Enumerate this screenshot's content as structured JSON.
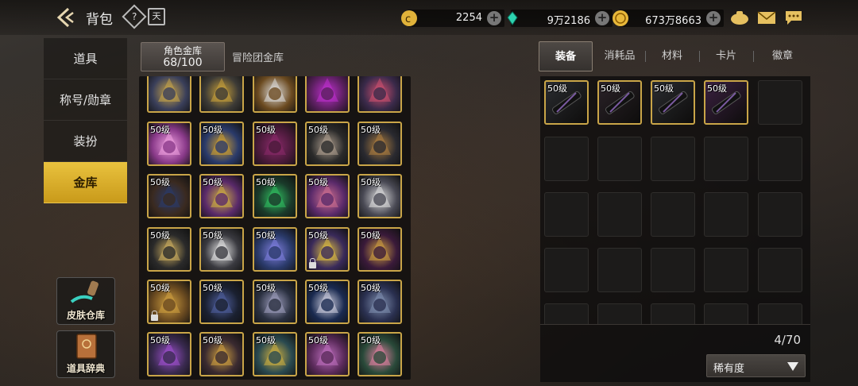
{
  "header": {
    "title": "背包",
    "help_glyph": "?",
    "calendar_glyph": "天",
    "currencies": [
      {
        "name": "gold-coin",
        "value": "2254",
        "color": "#e0b23a"
      },
      {
        "name": "crystal",
        "value": "9万2186",
        "color": "#2ed3b0"
      },
      {
        "name": "gold-medal",
        "value": "673万8663",
        "color": "#e8b83a"
      }
    ]
  },
  "sidebar": {
    "items": [
      {
        "label": "道具"
      },
      {
        "label": "称号/勋章"
      },
      {
        "label": "装扮"
      },
      {
        "label": "金库"
      }
    ],
    "shortcuts": [
      {
        "label": "皮肤仓库"
      },
      {
        "label": "道具辞典"
      }
    ]
  },
  "vault": {
    "tab_active_line1": "角色金库",
    "tab_active_line2": "68/100",
    "tab_other": "冒险团金库"
  },
  "grid_items": [
    {
      "level": "",
      "color": "#3a3f5a",
      "accent": "#c9a548",
      "rarity": "gold"
    },
    {
      "level": "",
      "color": "#3c3a36",
      "accent": "#caa23a",
      "rarity": "gold"
    },
    {
      "level": "",
      "color": "#6b4a20",
      "accent": "#ddd",
      "rarity": "gold"
    },
    {
      "level": "",
      "color": "#5a1f5e",
      "accent": "#c030d0",
      "rarity": "gold"
    },
    {
      "level": "",
      "color": "#3a2a4a",
      "accent": "#d05070",
      "rarity": "gold"
    },
    {
      "level": "50级",
      "color": "#8a3a8a",
      "accent": "#f0a0e0",
      "rarity": "gold"
    },
    {
      "level": "50级",
      "color": "#2a3a6a",
      "accent": "#d0a030",
      "rarity": "gold"
    },
    {
      "level": "50级",
      "color": "#4a1a3a",
      "accent": "#8a2a6a",
      "rarity": "gold"
    },
    {
      "level": "50级",
      "color": "#2a2a2a",
      "accent": "#b0a090",
      "rarity": "gold"
    },
    {
      "level": "50级",
      "color": "#2a2a30",
      "accent": "#b08040",
      "rarity": "gold"
    },
    {
      "level": "50级",
      "color": "#3a2a20",
      "accent": "#2a3a6a",
      "rarity": "gold"
    },
    {
      "level": "50级",
      "color": "#5a2a6a",
      "accent": "#d0b040",
      "rarity": "gold"
    },
    {
      "level": "50级",
      "color": "#1a3a2a",
      "accent": "#30c060",
      "rarity": "gold"
    },
    {
      "level": "50级",
      "color": "#5a2a6a",
      "accent": "#d07090",
      "rarity": "gold"
    },
    {
      "level": "50级",
      "color": "#4a4a55",
      "accent": "#e0e0e0",
      "rarity": "gold"
    },
    {
      "level": "50级",
      "color": "#2a2a2a",
      "accent": "#d0b060",
      "rarity": "gold"
    },
    {
      "level": "50级",
      "color": "#3a3a40",
      "accent": "#e8e8e8",
      "rarity": "gold"
    },
    {
      "level": "50级",
      "color": "#2a3a6a",
      "accent": "#8080e0",
      "rarity": "gold"
    },
    {
      "level": "50级",
      "color": "#3a2a5a",
      "accent": "#e0c040",
      "rarity": "gold",
      "locked": true
    },
    {
      "level": "50级",
      "color": "#3a1a3a",
      "accent": "#d0a040",
      "rarity": "gold"
    },
    {
      "level": "50级",
      "color": "#6a4a20",
      "accent": "#d0a040",
      "rarity": "gold",
      "locked": true
    },
    {
      "level": "50级",
      "color": "#1a2030",
      "accent": "#5060a0",
      "rarity": "gold"
    },
    {
      "level": "50级",
      "color": "#2a3040",
      "accent": "#a0a0c0",
      "rarity": "gold"
    },
    {
      "level": "50级",
      "color": "#1a2a50",
      "accent": "#d0d0e0",
      "rarity": "gold"
    },
    {
      "level": "50级",
      "color": "#2a3050",
      "accent": "#8090b0",
      "rarity": "gold"
    },
    {
      "level": "50级",
      "color": "#3a2a50",
      "accent": "#a050d0",
      "rarity": "gold"
    },
    {
      "level": "50级",
      "color": "#3a2a30",
      "accent": "#d0a040",
      "rarity": "gold"
    },
    {
      "level": "50级",
      "color": "#2a4a50",
      "accent": "#d0b040",
      "rarity": "gold"
    },
    {
      "level": "50级",
      "color": "#5a2a5a",
      "accent": "#c070c0",
      "rarity": "gold"
    },
    {
      "level": "50级",
      "color": "#2a4a3a",
      "accent": "#e080a0",
      "rarity": "gold"
    }
  ],
  "equipment_panel": {
    "tabs": [
      {
        "label": "装备"
      },
      {
        "label": "消耗品"
      },
      {
        "label": "材料"
      },
      {
        "label": "卡片"
      },
      {
        "label": "徽章"
      }
    ],
    "items": [
      {
        "level": "50级",
        "color": "#2a2c30"
      },
      {
        "level": "50级",
        "color": "#2a2228"
      },
      {
        "level": "50级",
        "color": "#2a2c30"
      },
      {
        "level": "50级",
        "color": "#3a2040"
      }
    ],
    "count": "4/70",
    "sort_label": "稀有度"
  }
}
